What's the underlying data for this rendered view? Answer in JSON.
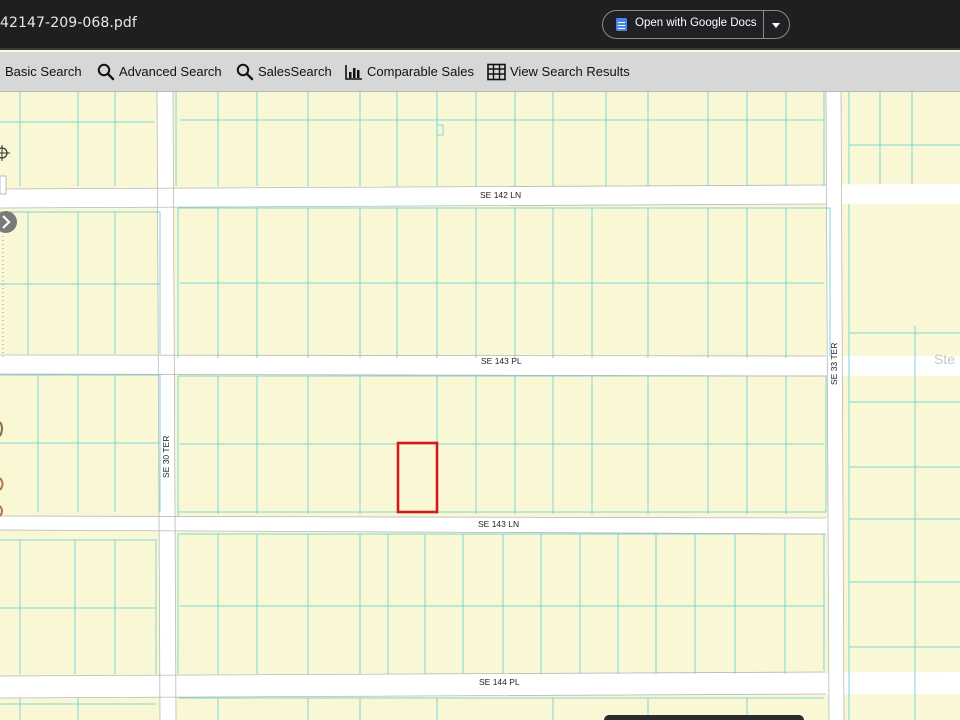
{
  "header": {
    "filename": "42147-209-068.pdf",
    "open_with_label": "Open with Google Docs",
    "icons": {
      "doc": "google-docs-icon",
      "dropdown": "chevron-down-icon"
    }
  },
  "toolbar": {
    "items": [
      {
        "label": "Basic Search",
        "icon": ""
      },
      {
        "label": "Advanced Search",
        "icon": "search-icon"
      },
      {
        "label": "SalesSearch",
        "icon": "search-icon"
      },
      {
        "label": "Comparable Sales",
        "icon": "bar-chart-icon"
      },
      {
        "label": "View Search Results",
        "icon": "table-grid-icon"
      }
    ]
  },
  "map": {
    "roads": {
      "r1": "SE 142 LN",
      "r2": "SE 143 PL",
      "r3": "SE 143 LN",
      "r4": "SE 144 PL",
      "v1": "SE 30 TER",
      "v2": "SE 33 TER"
    },
    "edge_text": "Ste",
    "colors": {
      "parcel_fill": "#faf8d4",
      "parcel_line": "#7fd3d8",
      "road": "#ffffff",
      "highlight": "#d21a1a"
    }
  }
}
